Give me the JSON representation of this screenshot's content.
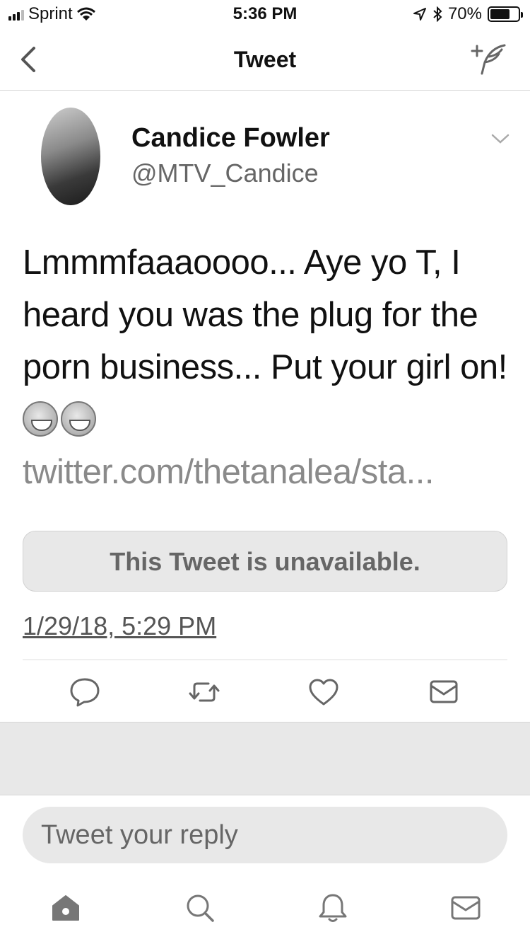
{
  "status_bar": {
    "carrier": "Sprint",
    "time": "5:36 PM",
    "battery": "70%",
    "battery_level": 0.7
  },
  "nav": {
    "title": "Tweet",
    "back_icon": "chevron-left-icon",
    "compose_icon": "compose-tweet-icon"
  },
  "tweet": {
    "author_name": "Candice Fowler",
    "author_handle": "@MTV_Candice",
    "text": "Lmmmfaaaoooo... Aye yo T, I heard you was the plug for the porn business... Put your girl on!",
    "emoji": "😂😂",
    "link": "twitter.com/thetanalea/sta...",
    "quoted_notice": "This Tweet is unavailable.",
    "timestamp": "1/29/18, 5:29 PM"
  },
  "actions": [
    "reply-icon",
    "retweet-icon",
    "like-icon",
    "direct-message-icon"
  ],
  "reply": {
    "placeholder": "Tweet your reply"
  },
  "tab_bar": [
    "home-icon",
    "search-icon",
    "notifications-icon",
    "messages-icon"
  ],
  "colors": {
    "text": "#111111",
    "muted": "#666666",
    "link": "#8a8a8a",
    "panel": "#e8e8e8"
  }
}
